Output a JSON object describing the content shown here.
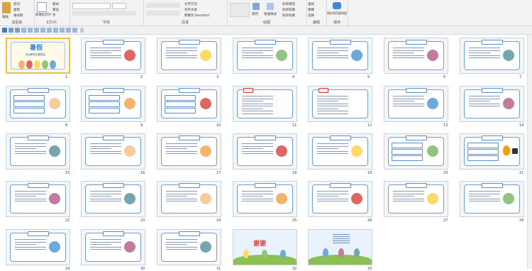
{
  "ribbon": {
    "groups": [
      {
        "label": "剪贴板",
        "items": [
          "剪切",
          "复制",
          "格式刷"
        ],
        "big": "粘贴"
      },
      {
        "label": "幻灯片",
        "items": [
          "版式",
          "重设",
          "节"
        ],
        "big": "新建幻灯片"
      },
      {
        "label": "字体",
        "items": []
      },
      {
        "label": "段落",
        "items": [
          "文字方向",
          "对齐文本",
          "转换为 SmartArt"
        ]
      },
      {
        "label": "绘图",
        "items": [
          "排列",
          "快速样式",
          "形状填充",
          "形状轮廓",
          "形状效果"
        ]
      },
      {
        "label": "编辑",
        "items": [
          "查找",
          "替换",
          "选择"
        ]
      },
      {
        "label": "保存",
        "items": [
          "保存到百度网盘"
        ]
      }
    ]
  },
  "slides": [
    {
      "n": "1",
      "kind": "title",
      "title": "暑假",
      "sub": "安全教育主题班会"
    },
    {
      "n": "2",
      "kind": "text-img"
    },
    {
      "n": "3",
      "kind": "text-img"
    },
    {
      "n": "4",
      "kind": "text-img"
    },
    {
      "n": "5",
      "kind": "text-img"
    },
    {
      "n": "6",
      "kind": "text-img"
    },
    {
      "n": "7",
      "kind": "text-img"
    },
    {
      "n": "8",
      "kind": "boxes-img"
    },
    {
      "n": "9",
      "kind": "boxes-img"
    },
    {
      "n": "10",
      "kind": "boxes-img"
    },
    {
      "n": "11",
      "kind": "red-text"
    },
    {
      "n": "12",
      "kind": "red-text"
    },
    {
      "n": "13",
      "kind": "text-img"
    },
    {
      "n": "14",
      "kind": "text-img"
    },
    {
      "n": "15",
      "kind": "text-img"
    },
    {
      "n": "16",
      "kind": "text-img"
    },
    {
      "n": "17",
      "kind": "text-img"
    },
    {
      "n": "18",
      "kind": "text-img"
    },
    {
      "n": "19",
      "kind": "text-img"
    },
    {
      "n": "20",
      "kind": "boxes-img"
    },
    {
      "n": "21",
      "kind": "fire"
    },
    {
      "n": "22",
      "kind": "text-img"
    },
    {
      "n": "23",
      "kind": "text-img"
    },
    {
      "n": "24",
      "kind": "text-img"
    },
    {
      "n": "25",
      "kind": "text-img"
    },
    {
      "n": "26",
      "kind": "text-img"
    },
    {
      "n": "27",
      "kind": "text-img"
    },
    {
      "n": "28",
      "kind": "text-img"
    },
    {
      "n": "29",
      "kind": "text-img"
    },
    {
      "n": "30",
      "kind": "text-img"
    },
    {
      "n": "31",
      "kind": "text-img"
    },
    {
      "n": "32",
      "kind": "thanks",
      "title": "谢谢"
    },
    {
      "n": "33",
      "kind": "end"
    }
  ],
  "colors": {
    "accent": "#6f9fd8",
    "selected": "#f1c232"
  }
}
